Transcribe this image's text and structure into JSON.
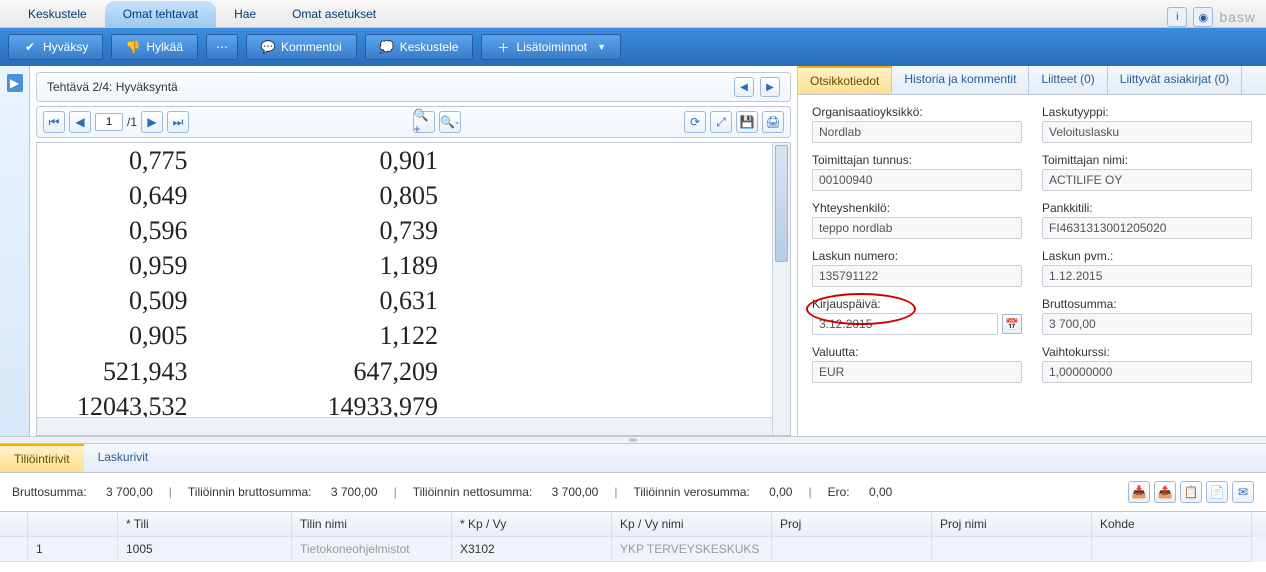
{
  "topnav": {
    "tabs": [
      "Keskustele",
      "Omat tehtavat",
      "Hae",
      "Omat asetukset"
    ],
    "active": 1,
    "brand": "basw"
  },
  "toolbar": {
    "approve": "Hyväksy",
    "reject": "Hylkää",
    "comment": "Kommentoi",
    "discuss": "Keskustele",
    "more": "Lisätoiminnot"
  },
  "task": {
    "title": "Tehtävä 2/4: Hyväksyntä"
  },
  "viewer": {
    "page": "1",
    "page_total": "/1"
  },
  "doc": {
    "col1": [
      "0,775",
      "0,649",
      "0,596",
      "0,959",
      "0,509",
      "0,905",
      "521,943",
      "12043,532"
    ],
    "col2": [
      "0,901",
      "0,805",
      "0,739",
      "1,189",
      "0,631",
      "1,122",
      "647,209",
      "14933,979"
    ]
  },
  "rtabs": [
    "Otsikkotiedot",
    "Historia ja kommentit",
    "Liitteet (0)",
    "Liittyvät asiakirjat (0)"
  ],
  "details": {
    "org_label": "Organisaatioyksikkö:",
    "org": "Nordlab",
    "invtype_label": "Laskutyyppi:",
    "invtype": "Veloituslasku",
    "supcode_label": "Toimittajan tunnus:",
    "supcode": "00100940",
    "supname_label": "Toimittajan nimi:",
    "supname": "ACTILIFE OY",
    "contact_label": "Yhteyshenkilö:",
    "contact": "teppo nordlab",
    "bank_label": "Pankkitili:",
    "bank": "FI4631313001205020",
    "invnum_label": "Laskun numero:",
    "invnum": "135791122",
    "invdate_label": "Laskun pvm.:",
    "invdate": "1.12.2015",
    "postdate_label": "Kirjauspäivä:",
    "postdate": "3.12.2015",
    "gross_label": "Bruttosumma:",
    "gross": "3 700,00",
    "currency_label": "Valuutta:",
    "currency": "EUR",
    "rate_label": "Vaihtokurssi:",
    "rate": "1,00000000"
  },
  "btabs": [
    "Tiliöintirivit",
    "Laskurivit"
  ],
  "sums": {
    "brutto_l": "Bruttosumma:",
    "brutto_v": "3 700,00",
    "tbrutto_l": "Tiliöinnin bruttosumma:",
    "tbrutto_v": "3 700,00",
    "tnetto_l": "Tiliöinnin nettosumma:",
    "tnetto_v": "3 700,00",
    "tvat_l": "Tiliöinnin verosumma:",
    "tvat_v": "0,00",
    "diff_l": "Ero:",
    "diff_v": "0,00"
  },
  "grid": {
    "headers": [
      "",
      "",
      "* Tili",
      "Tilin nimi",
      "* Kp / Vy",
      "Kp / Vy nimi",
      "Proj",
      "Proj nimi",
      "Kohde"
    ],
    "row": {
      "num": "1",
      "tili": "1005",
      "tilin_nimi": "Tietokoneohjelmistot",
      "kpvy": "X3102",
      "kpvy_nimi": "YKP TERVEYSKESKUKS",
      "proj": "",
      "proj_nimi": "",
      "kohde": ""
    }
  }
}
